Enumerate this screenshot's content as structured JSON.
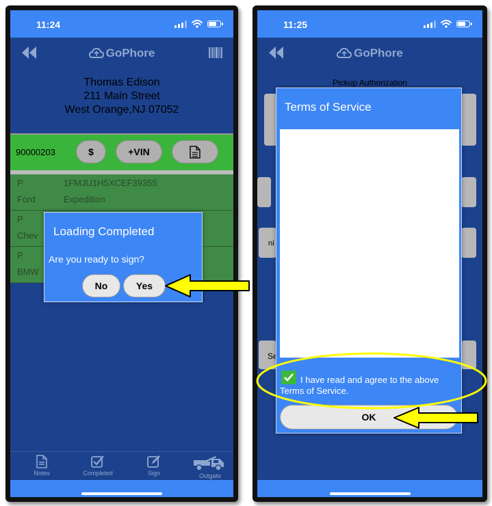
{
  "left_phone": {
    "status": {
      "time": "11:24"
    },
    "header": {
      "brand": "GoPhore",
      "back_icon": "double-chevron-left-icon",
      "barcode_icon": "barcode-icon"
    },
    "customer": {
      "name": "Thomas Edison",
      "street": "211 Main Street",
      "city": "West Orange,NJ 07052"
    },
    "action_bar": {
      "order_number": "90000203",
      "pay_label": "$",
      "add_vin_label": "+VIN",
      "doc_icon": "document-icon"
    },
    "vehicles": [
      {
        "type": "P",
        "vin": "1FMJU1H5XCEF39355",
        "make": "Ford",
        "model": "Expedition"
      },
      {
        "type": "P",
        "vin": "",
        "make": "Chev",
        "model": ""
      },
      {
        "type": "P",
        "vin": "",
        "make": "BMW",
        "model": ""
      }
    ],
    "dialog": {
      "title": "Loading Completed",
      "message": "Are you ready to sign?",
      "no_label": "No",
      "yes_label": "Yes"
    },
    "tabs": [
      {
        "label": "Notes",
        "icon": "notes-icon"
      },
      {
        "label": "Completed",
        "icon": "completed-icon"
      },
      {
        "label": "Sign",
        "icon": "sign-icon"
      },
      {
        "label": "Outgate",
        "icon": "tow-truck-icon"
      }
    ]
  },
  "right_phone": {
    "status": {
      "time": "11:25"
    },
    "header": {
      "brand": "GoPhore",
      "back_icon": "double-chevron-left-icon"
    },
    "page_title": "Pickup Authorization",
    "partial_labels": {
      "ni": "ni",
      "se": "Se"
    },
    "dialog": {
      "title": "Terms of Service",
      "agree_text": "I have read and agree to the above Terms of Service.",
      "agree_checked": true,
      "ok_label": "OK"
    }
  },
  "colors": {
    "app_blue": "#1c428e",
    "accent_blue": "#3d86f5",
    "green_bar": "#3bb43b",
    "row_green": "#3f8a46",
    "callout_yellow": "#ffff00",
    "check_green": "#3db83d"
  }
}
